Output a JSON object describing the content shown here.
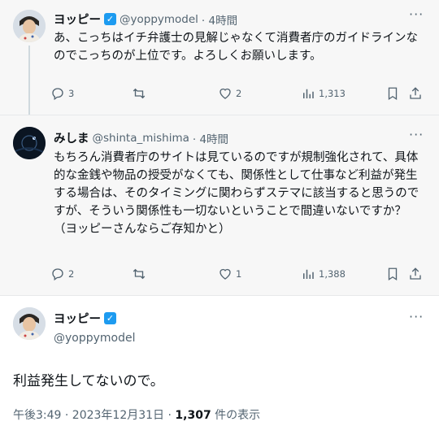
{
  "tweets": [
    {
      "display_name": "ヨッピー",
      "verified": true,
      "handle": "@yoppymodel",
      "time": "· 4時間",
      "text": "あ、こっちはイチ弁護士の見解じゃなくて消費者庁のガイドラインなのでこっちのが上位です。よろしくお願いします。",
      "replies": "3",
      "reposts": "",
      "likes": "2",
      "views": "1,313"
    },
    {
      "display_name": "みしま",
      "verified": false,
      "handle": "@shinta_mishima",
      "time": "· 4時間",
      "text": "もちろん消費者庁のサイトは見ているのですが規制強化されて、具体的な金銭や物品の授受がなくても、関係性として仕事など利益が発生する場合は、そのタイミングに関わらずステマに該当すると思うのですが、そういう関係性も一切ないということで間違いないですか？（ヨッピーさんならご存知かと）",
      "replies": "2",
      "reposts": "",
      "likes": "1",
      "views": "1,388"
    }
  ],
  "main_tweet": {
    "display_name": "ヨッピー",
    "verified": true,
    "handle": "@yoppymodel",
    "text": "利益発生してないので。",
    "timestamp": "午後3:49 · 2023年12月31日 · ",
    "view_count": "1,307",
    "view_label": " 件の表示"
  },
  "icons": {
    "more": "more-options-icon",
    "reply": "reply-icon",
    "repost": "repost-icon",
    "like": "like-icon",
    "views": "views-icon",
    "bookmark": "bookmark-icon",
    "share": "share-icon",
    "verified": "verified-badge-icon"
  },
  "colors": {
    "verified": "#1d9bf0",
    "secondary_text": "#536471",
    "text": "#0f1419",
    "thread_line": "#cfd9de"
  }
}
